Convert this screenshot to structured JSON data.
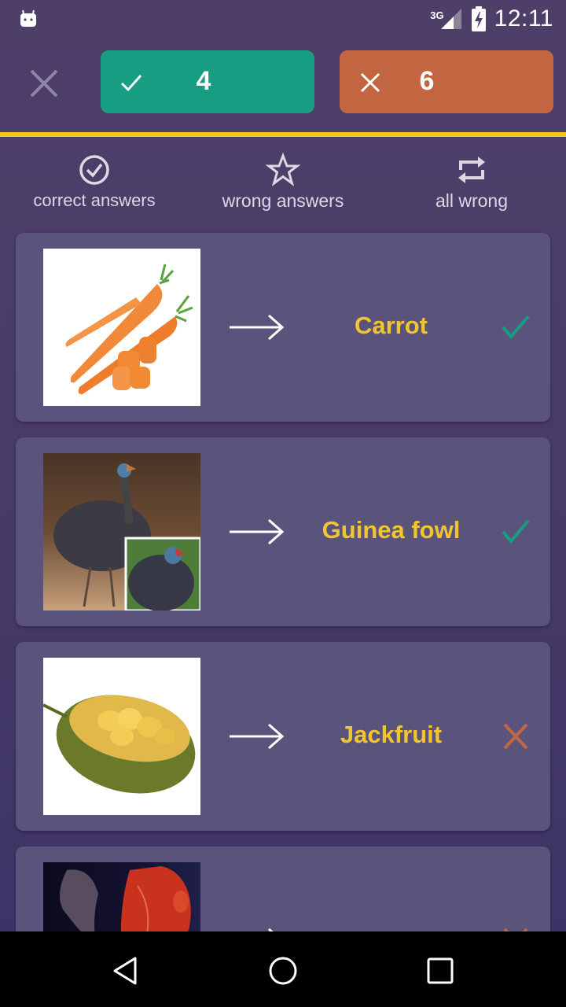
{
  "status_bar": {
    "network": "3G",
    "time": "12:11",
    "icons": [
      "android-debug-icon",
      "signal-icon",
      "battery-charging-icon"
    ]
  },
  "top_bar": {
    "close_icon": "close-icon",
    "correct": {
      "icon": "check-icon",
      "count": "4",
      "color": "#179e82"
    },
    "wrong": {
      "icon": "x-icon",
      "count": "6",
      "color": "#c26642"
    },
    "progress_color": "#f5c319"
  },
  "filters": [
    {
      "icon": "check-circle-icon",
      "label": "correct answers"
    },
    {
      "icon": "star-outline-icon",
      "label": "wrong answers"
    },
    {
      "icon": "repeat-icon",
      "label": "all wrong"
    }
  ],
  "items": [
    {
      "image": "carrot-image",
      "label": "Carrot",
      "result": "correct"
    },
    {
      "image": "guinea-fowl-image",
      "label": "Guinea fowl",
      "result": "correct"
    },
    {
      "image": "jackfruit-image",
      "label": "Jackfruit",
      "result": "wrong"
    },
    {
      "image": "heart-anatomy-image",
      "label": "",
      "result": "wrong"
    }
  ],
  "colors": {
    "label": "#f2c530",
    "correct": "#179e82",
    "wrong": "#c26642",
    "card": "#5a547c",
    "background": "#4b3f68"
  },
  "nav_bar": {
    "back": "back-icon",
    "home": "home-icon",
    "recents": "recents-icon"
  }
}
